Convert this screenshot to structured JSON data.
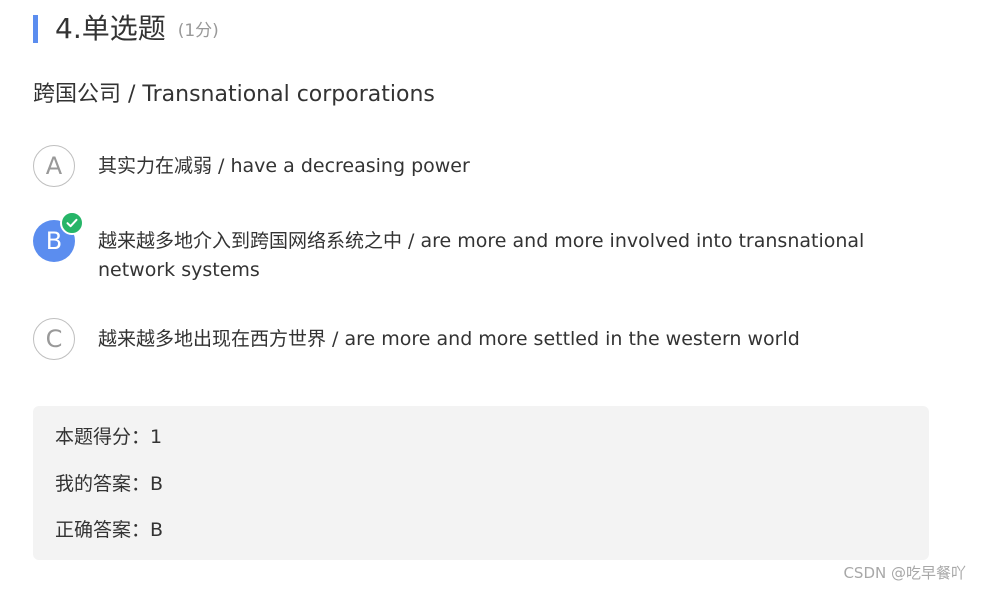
{
  "question": {
    "title": "4.单选题",
    "score": "(1分)",
    "stem": "跨国公司 / Transnational corporations"
  },
  "options": [
    {
      "letter": "A",
      "text": "其实力在减弱 / have a decreasing power",
      "selected": false
    },
    {
      "letter": "B",
      "text": "越来越多地介入到跨国网络系统之中 /  are more and more involved into transnational network systems",
      "selected": true
    },
    {
      "letter": "C",
      "text": "越来越多地出现在西方世界 / are more and more settled in the western world",
      "selected": false
    }
  ],
  "result": {
    "score_label": "本题得分：1",
    "my_answer_label": "我的答案：B",
    "correct_answer_label": "正确答案：B"
  },
  "watermark": "CSDN @吃早餐吖",
  "colors": {
    "accent": "#5b8def",
    "check": "#26b568",
    "panel": "#f3f3f3"
  },
  "icons": {
    "check": "check-icon"
  }
}
